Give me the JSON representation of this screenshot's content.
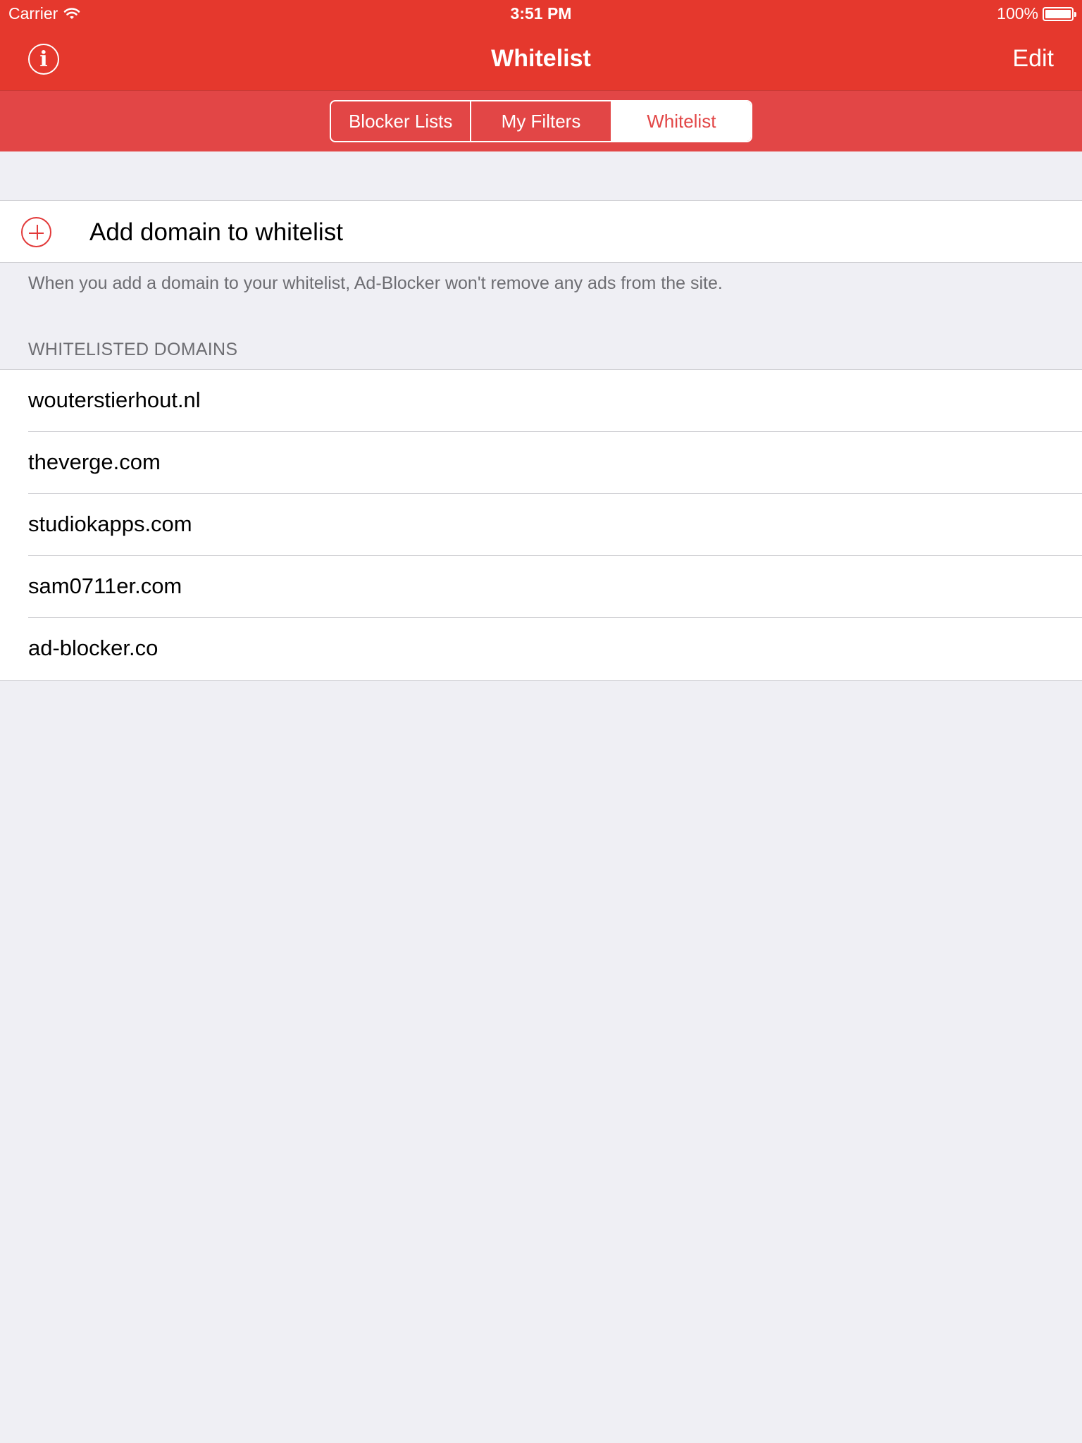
{
  "status_bar": {
    "carrier": "Carrier",
    "time": "3:51 PM",
    "battery": "100%"
  },
  "nav": {
    "title": "Whitelist",
    "edit_label": "Edit",
    "info_icon": "i"
  },
  "segments": [
    {
      "label": "Blocker Lists",
      "active": false
    },
    {
      "label": "My Filters",
      "active": false
    },
    {
      "label": "Whitelist",
      "active": true
    }
  ],
  "add_row": {
    "label": "Add domain to whitelist"
  },
  "footer_note": "When you add a domain to your whitelist, Ad-Blocker won't remove any ads from the site.",
  "section_header": "WHITELISTED DOMAINS",
  "domains": [
    "wouterstierhout.nl",
    "theverge.com",
    "studiokapps.com",
    "sam0711er.com",
    "ad-blocker.co"
  ],
  "colors": {
    "accent": "#e5382d",
    "segment_bg": "#e24646",
    "background": "#efeff4"
  }
}
